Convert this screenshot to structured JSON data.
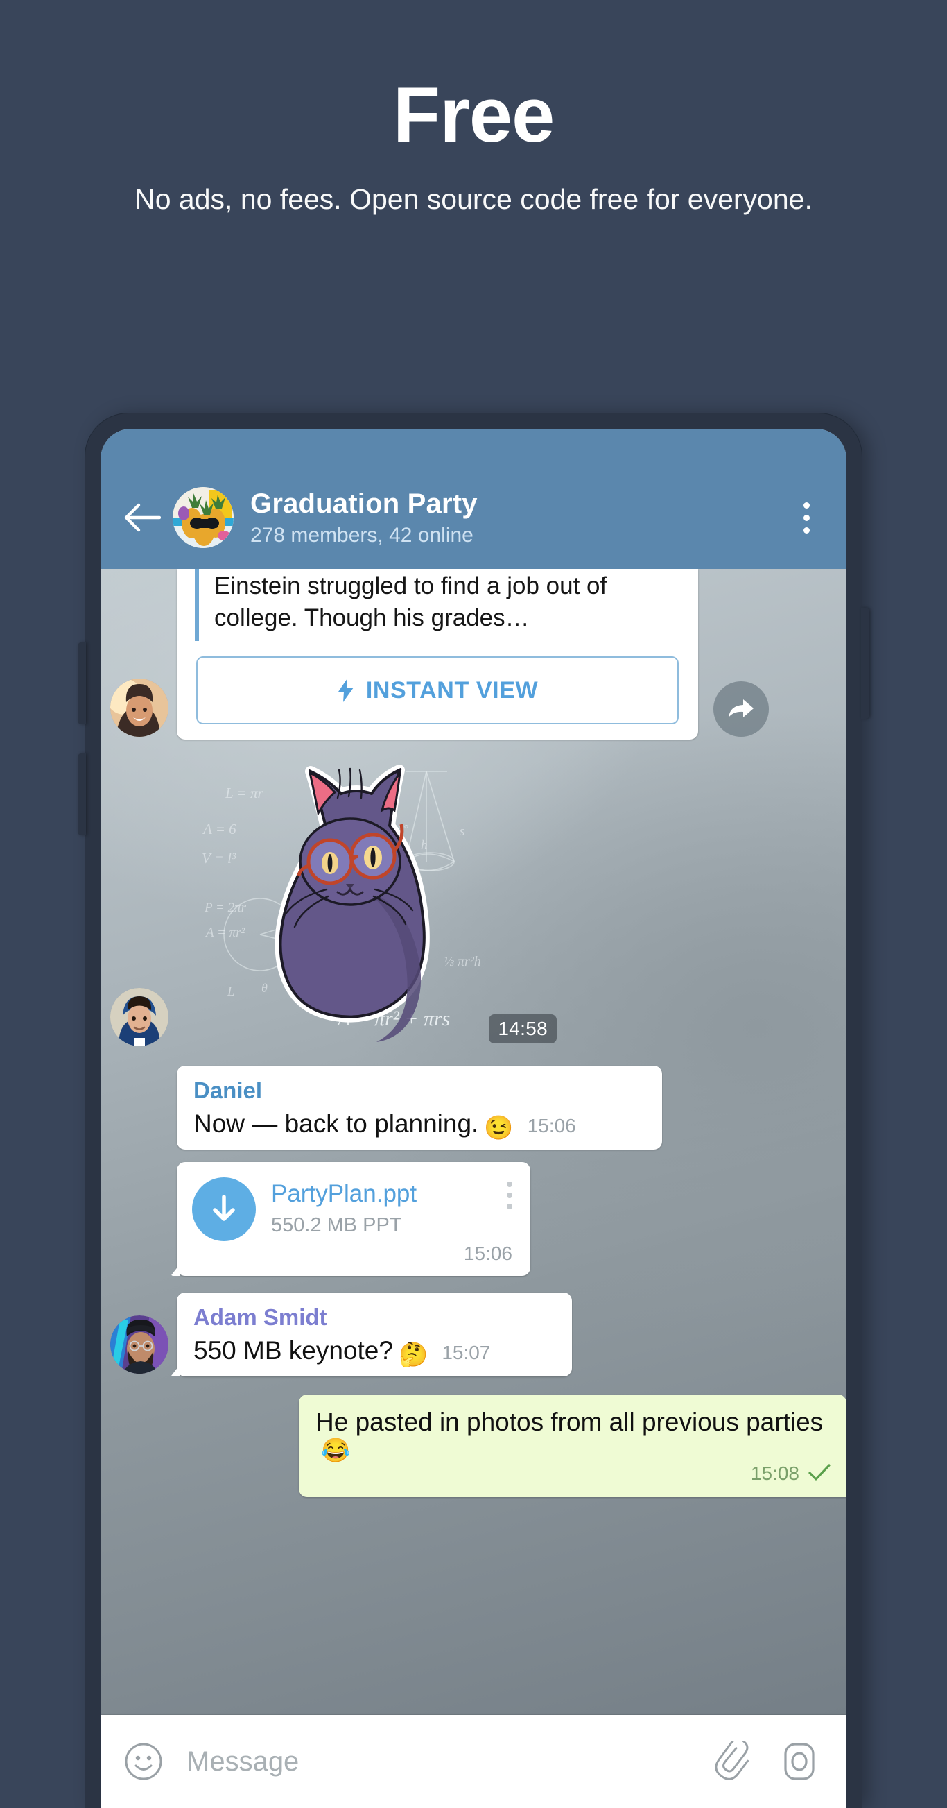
{
  "promo": {
    "title": "Free",
    "subtitle": "No ads, no fees. Open source code free for everyone."
  },
  "colors": {
    "page_background": "#39455a",
    "chat_bar": "#5b87ad",
    "accent_link": "#53a0dc",
    "outgoing_bubble": "#effbd4",
    "sender_blue": "#4a8fc4",
    "sender_purple": "#7c7ed0",
    "download_circle": "#5eaee4",
    "check_green": "#5aa04b"
  },
  "chat_header": {
    "back_icon": "arrow-left-icon",
    "avatar": "pineapple-sunglasses-avatar",
    "title": "Graduation Party",
    "subtitle": "278 members, 42 online",
    "menu_icon": "more-vertical-icon"
  },
  "messages": [
    {
      "type": "link_preview",
      "avatar": "woman-smiling-avatar",
      "preview_text": "Einstein struggled to find a job out of college. Though his grades…",
      "instant_view_label": "INSTANT VIEW",
      "instant_view_icon": "lightning-bolt-icon",
      "share_icon": "forward-arrow-icon"
    },
    {
      "type": "sticker",
      "avatar": "hooded-person-avatar",
      "sticker_name": "math-cat-sticker",
      "time": "14:58"
    },
    {
      "type": "text",
      "sender": "Daniel",
      "sender_color": "blue",
      "text": "Now — back to planning.",
      "emoji": "😉",
      "time": "15:06"
    },
    {
      "type": "file",
      "avatar": "man-sunglasses-avatar",
      "download_icon": "download-arrow-icon",
      "file_name": "PartyPlan.ppt",
      "file_size": "550.2 MB PPT",
      "menu_icon": "more-vertical-icon",
      "time": "15:06"
    },
    {
      "type": "text",
      "sender": "Adam Smidt",
      "sender_color": "purple",
      "avatar": "bearded-man-beanie-avatar",
      "text": "550 MB keynote?",
      "emoji": "🤔",
      "time": "15:07"
    },
    {
      "type": "outgoing",
      "text": "He pasted in photos from all previous parties",
      "emoji": "😂",
      "time": "15:08",
      "status_icon": "check-icon"
    }
  ],
  "input_bar": {
    "emoji_icon": "smiley-icon",
    "placeholder": "Message",
    "attach_icon": "paperclip-icon",
    "camera_icon": "camera-icon"
  }
}
